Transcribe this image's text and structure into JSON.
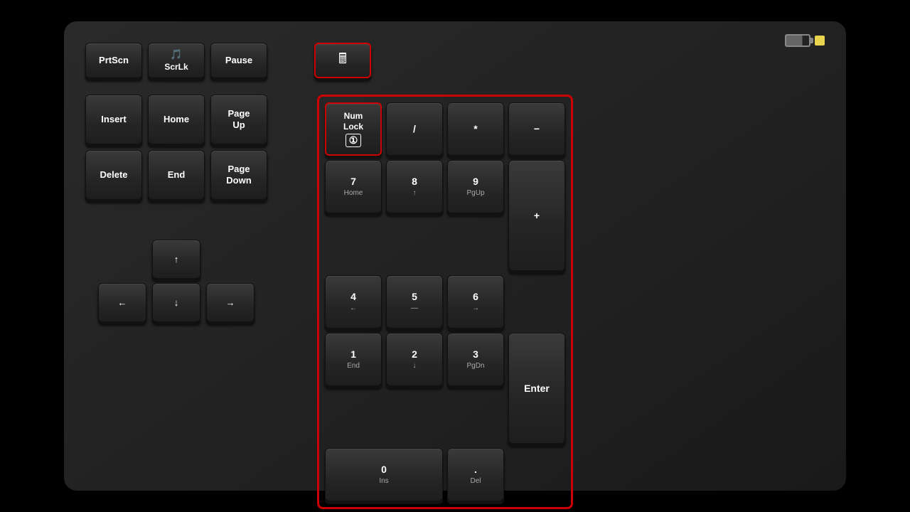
{
  "keyboard": {
    "status": {
      "battery_label": "battery",
      "led_label": "led"
    },
    "top_row": [
      {
        "id": "prtscn",
        "label": "PrtScn"
      },
      {
        "id": "scrlk",
        "label": "ScrLk",
        "has_icon": true
      },
      {
        "id": "pause",
        "label": "Pause"
      }
    ],
    "nav_row1": [
      {
        "id": "insert",
        "label": "Insert"
      },
      {
        "id": "home",
        "label": "Home"
      },
      {
        "id": "pageup",
        "label": "Page\nUp",
        "line1": "Page",
        "line2": "Up"
      }
    ],
    "nav_row2": [
      {
        "id": "delete",
        "label": "Delete"
      },
      {
        "id": "end",
        "label": "End"
      },
      {
        "id": "pagedown",
        "label": "Page\nDown",
        "line1": "Page",
        "line2": "Down"
      }
    ],
    "arrows": {
      "up": "↑",
      "left": "←",
      "down": "↓",
      "right": "→"
    },
    "numpad": {
      "calc_icon": "🖩",
      "keys": [
        {
          "id": "numlock",
          "main": "Num\nLock",
          "sub": "①",
          "highlighted": true
        },
        {
          "id": "numdiv",
          "main": "/",
          "sub": ""
        },
        {
          "id": "nummul",
          "main": "*",
          "sub": ""
        },
        {
          "id": "numsub",
          "main": "−",
          "sub": ""
        },
        {
          "id": "num7",
          "main": "7",
          "sub": "Home"
        },
        {
          "id": "num8",
          "main": "8",
          "sub": "↑"
        },
        {
          "id": "num9",
          "main": "9",
          "sub": "PgUp"
        },
        {
          "id": "numadd",
          "main": "+",
          "sub": "",
          "tall": true
        },
        {
          "id": "num4",
          "main": "4",
          "sub": "←"
        },
        {
          "id": "num5",
          "main": "5",
          "sub": "—"
        },
        {
          "id": "num6",
          "main": "6",
          "sub": "→"
        },
        {
          "id": "num1",
          "main": "1",
          "sub": "End"
        },
        {
          "id": "num2",
          "main": "2",
          "sub": "↓"
        },
        {
          "id": "num3",
          "main": "3",
          "sub": "PgDn"
        },
        {
          "id": "numenter",
          "main": "Enter",
          "sub": "",
          "tall": true
        },
        {
          "id": "num0",
          "main": "0",
          "sub": "Ins",
          "wide": true
        },
        {
          "id": "numdot",
          "main": ".",
          "sub": "Del"
        }
      ]
    }
  }
}
